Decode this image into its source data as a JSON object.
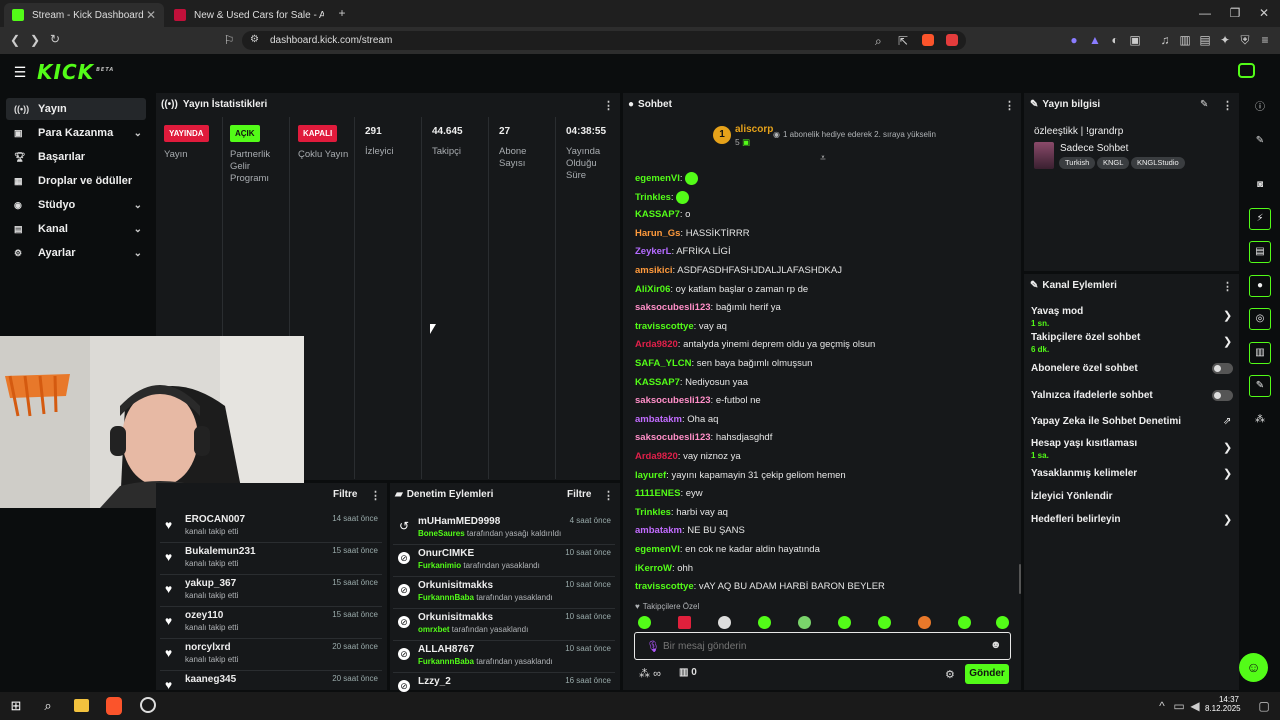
{
  "browser": {
    "tabs": [
      {
        "title": "Stream - Kick Dashboard",
        "active": true
      },
      {
        "title": "New & Used Cars for Sale - Autotrad",
        "active": false
      }
    ],
    "url": "dashboard.kick.com/stream"
  },
  "app": {
    "logo": "KICK",
    "logo_beta": "BETA",
    "accent": "#53fc18"
  },
  "sidebar": {
    "items": [
      {
        "label": "Yayın",
        "icon": "broadcast-icon",
        "active": true,
        "chevron": false
      },
      {
        "label": "Para Kazanma",
        "icon": "money-icon",
        "active": false,
        "chevron": true
      },
      {
        "label": "Başarılar",
        "icon": "trophy-icon",
        "active": false,
        "chevron": false
      },
      {
        "label": "Droplar ve ödüller",
        "icon": "gift-icon",
        "active": false,
        "chevron": false
      },
      {
        "label": "Stüdyo",
        "icon": "studio-icon",
        "active": false,
        "chevron": true
      },
      {
        "label": "Kanal",
        "icon": "channel-icon",
        "active": false,
        "chevron": true
      },
      {
        "label": "Ayarlar",
        "icon": "gear-icon",
        "active": false,
        "chevron": true
      }
    ]
  },
  "stats": {
    "title": "Yayın İstatistikleri",
    "columns": [
      {
        "badge": "YAYINDA",
        "badge_color": "#e01b3c",
        "label": "Yayın"
      },
      {
        "badge": "AÇIK",
        "badge_color": "#53fc18",
        "label": "Partnerlik\nGelir\nProgramı"
      },
      {
        "badge": "KAPALI",
        "badge_color": "#e01b3c",
        "label": "Çoklu Yayın"
      },
      {
        "value": "291",
        "label": "İzleyici"
      },
      {
        "value": "44.645",
        "label": "Takipçi"
      },
      {
        "value": "27",
        "label": "Abone\nSayısı"
      },
      {
        "value": "04:38:55",
        "label": "Yayında\nOlduğu\nSüre"
      }
    ]
  },
  "follows": {
    "filter": "Filtre",
    "rows": [
      {
        "name": "EROCAN007",
        "sub": "kanalı takip etti",
        "time": "14 saat önce"
      },
      {
        "name": "Bukalemun231",
        "sub": "kanalı takip etti",
        "time": "15 saat önce"
      },
      {
        "name": "yakup_367",
        "sub": "kanalı takip etti",
        "time": "15 saat önce"
      },
      {
        "name": "ozey110",
        "sub": "kanalı takip etti",
        "time": "15 saat önce"
      },
      {
        "name": "norcylxrd",
        "sub": "kanalı takip etti",
        "time": "20 saat önce"
      },
      {
        "name": "kaaneg345",
        "sub": "",
        "time": "20 saat önce"
      }
    ]
  },
  "moderation": {
    "title": "Denetim Eylemleri",
    "filter": "Filtre",
    "rows": [
      {
        "name": "mUHamMED9998",
        "actor": "BoneSaures",
        "action": "tarafından yasağı kaldırıldı",
        "time": "4 saat önce",
        "icon": "unban-icon"
      },
      {
        "name": "OnurCIMKE",
        "actor": "Furkanimio",
        "action": "tarafından yasaklandı",
        "time": "10 saat önce",
        "icon": "ban-icon"
      },
      {
        "name": "Orkunisitmakks",
        "actor": "FurkannnBaba",
        "action": "tarafından yasaklandı",
        "time": "10 saat önce",
        "icon": "ban-icon"
      },
      {
        "name": "Orkunisitmakks",
        "actor": "omrxbet",
        "action": "tarafından yasaklandı",
        "time": "10 saat önce",
        "icon": "ban-icon"
      },
      {
        "name": "ALLAH8767",
        "actor": "FurkannnBaba",
        "action": "tarafından yasaklandı",
        "time": "10 saat önce",
        "icon": "ban-icon"
      },
      {
        "name": "Lzzy_2",
        "actor": "",
        "action": "",
        "time": "16 saat önce",
        "icon": "ban-icon"
      }
    ]
  },
  "chat": {
    "title": "Sohbet",
    "top_gifter": {
      "name": "aliscorp",
      "count": "5",
      "rank": "1",
      "promo": "1 abonelik hediye ederek 2. sıraya yükselin"
    },
    "messages": [
      {
        "user": "egemenVI",
        "color": "#53fc18",
        "text": "",
        "emote": true
      },
      {
        "user": "Trinkles",
        "color": "#53fc18",
        "text": "",
        "emote": true
      },
      {
        "user": "KASSAP7",
        "color": "#53fc18",
        "text": "o"
      },
      {
        "user": "Harun_Gs",
        "color": "#ff9a3c",
        "text": "HASSİKTİRRR"
      },
      {
        "user": "ZeykerL",
        "color": "#b46bff",
        "text": "AFRİKA LİGİ"
      },
      {
        "user": "amsikici",
        "color": "#ff9a3c",
        "text": "ASDFASDHFASHJDALJLAFASHDKAJ"
      },
      {
        "user": "AliXir06",
        "color": "#53fc18",
        "text": "oy katlam başlar o zaman rp de"
      },
      {
        "user": "saksocubesli123",
        "color": "#ff8fc8",
        "text": "bağımlı herif ya"
      },
      {
        "user": "travisscottye",
        "color": "#53fc18",
        "text": "vay aq"
      },
      {
        "user": "Arda9820",
        "color": "#e0204a",
        "text": "antalyda yinemi deprem oldu ya geçmiş olsun"
      },
      {
        "user": "SAFA_YLCN",
        "color": "#53fc18",
        "text": "sen baya bağımlı olmuşsun"
      },
      {
        "user": "KASSAP7",
        "color": "#53fc18",
        "text": "Nediyosun yaa"
      },
      {
        "user": "saksocubesli123",
        "color": "#ff8fc8",
        "text": "e-futbol ne"
      },
      {
        "user": "ambatakm",
        "color": "#c26cff",
        "text": "Oha aq"
      },
      {
        "user": "saksocubesli123",
        "color": "#ff8fc8",
        "text": "hahsdjasghdf"
      },
      {
        "user": "Arda9820",
        "color": "#e0204a",
        "text": "vay niznoz ya"
      },
      {
        "user": "layuref",
        "color": "#53fc18",
        "text": "yayını kapamayin 31 çekip geliom hemen"
      },
      {
        "user": "1111ENES",
        "color": "#53fc18",
        "text": "eyw"
      },
      {
        "user": "Trinkles",
        "color": "#53fc18",
        "text": "harbi vay aq"
      },
      {
        "user": "ambatakm",
        "color": "#c26cff",
        "text": "NE BU ŞANS"
      },
      {
        "user": "egemenVI",
        "color": "#53fc18",
        "text": "en cok ne kadar aldin hayatında"
      },
      {
        "user": "iKerroW",
        "color": "#53fc18",
        "text": "ohh"
      },
      {
        "user": "travisscottye",
        "color": "#53fc18",
        "text": "vAY AQ BU ADAM HARBİ BARON BEYLER"
      }
    ],
    "followers_only": "Takipçilere Özel",
    "input_placeholder": "Bir mesaj gönderin",
    "infinity": "∞",
    "counter": "0",
    "send": "Gönder"
  },
  "stream_info": {
    "title": "Yayın bilgisi",
    "stream_title": "özleeştikk | !grandrp",
    "category": "Sadece Sohbet",
    "tags": [
      "Turkish",
      "KNGL",
      "KNGLStudio"
    ]
  },
  "channel_actions": {
    "title": "Kanal Eylemleri",
    "items": [
      {
        "label": "Yavaş mod",
        "sub": "1 sn.",
        "control": "chevron"
      },
      {
        "label": "Takipçilere özel sohbet",
        "sub": "6 dk.",
        "control": "chevron"
      },
      {
        "label": "Abonelere özel sohbet",
        "sub": "",
        "control": "toggle"
      },
      {
        "label": "Yalnızca ifadelerle sohbet",
        "sub": "",
        "control": "toggle"
      },
      {
        "label": "Yapay Zeka ile Sohbet Denetimi",
        "sub": "",
        "control": "external"
      },
      {
        "label": "Hesap yaşı kısıtlaması",
        "sub": "1 sa.",
        "control": "chevron"
      },
      {
        "label": "Yasaklanmış kelimeler",
        "sub": "",
        "control": "chevron"
      },
      {
        "label": "İzleyici Yönlendir",
        "sub": "",
        "control": "none"
      },
      {
        "label": "Hedefleri belirleyin",
        "sub": "",
        "control": "chevron"
      }
    ]
  },
  "taskbar": {
    "time": "14:37",
    "date": "8.12.2025"
  }
}
